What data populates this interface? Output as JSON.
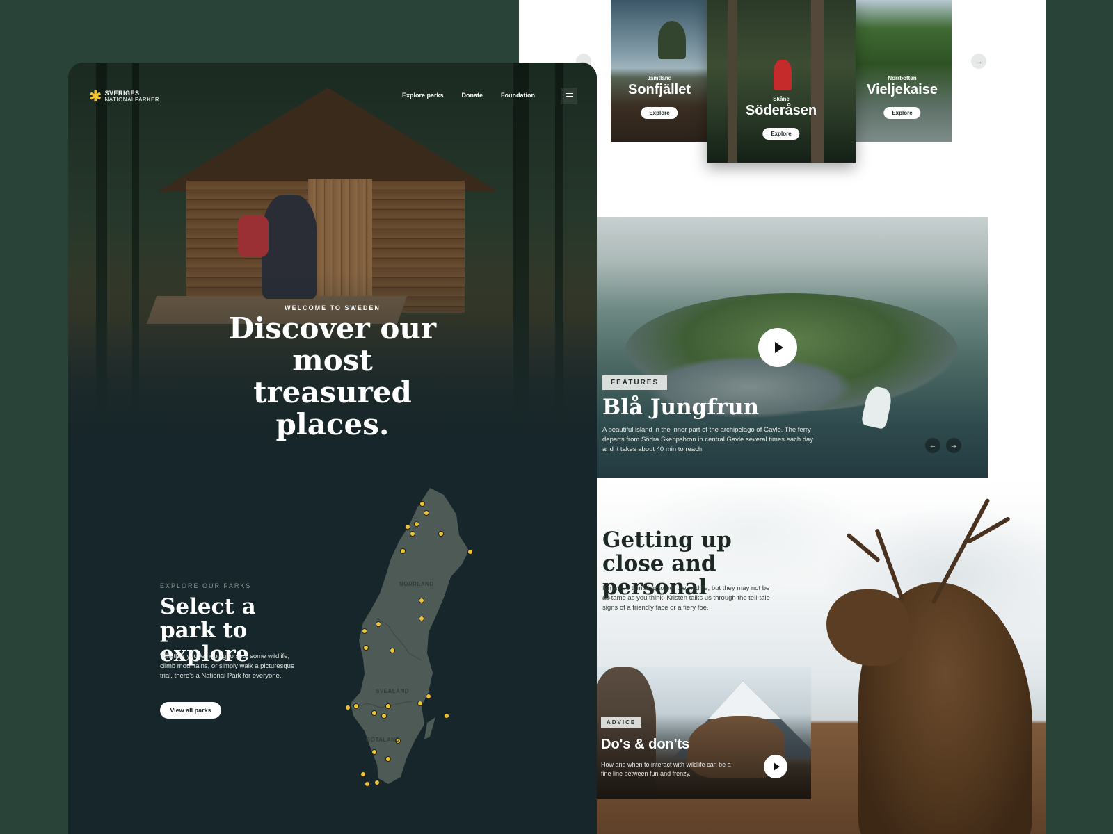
{
  "right_page": {
    "parks": [
      {
        "region": "Jämtland",
        "name": "Sonfjället",
        "explore": "Explore"
      },
      {
        "region": "Skåne",
        "name": "Söderåsen",
        "explore": "Explore"
      },
      {
        "region": "Norrbotten",
        "name": "Vieljekaise",
        "explore": "Explore"
      }
    ],
    "feature": {
      "tag": "FEATURES",
      "title": "Blå Jungfrun",
      "description": "A beautiful island in the inner part of the archipelago of Gavle. The ferry departs from Södra Skeppsbron in central Gavle several times each day and it takes about 40 min to reach"
    },
    "close_personal": {
      "title": "Getting up close and personal",
      "body": "It may be tempting to pet the wildlife, but they may not be as tame as you think. Kristen talks us through the tell-tale signs of a friendly face or a fiery foe."
    },
    "advice": {
      "tag": "ADVICE",
      "title": "Do's & don'ts",
      "description": "How and when to interact with wildlife can be a fine line between fun and frenzy."
    }
  },
  "left_page": {
    "logo": {
      "line1": "SVERIGES",
      "line2": "NATIONALPARKER"
    },
    "nav": {
      "explore": "Explore parks",
      "donate": "Donate",
      "foundation": "Foundation"
    },
    "hero": {
      "kicker": "WELCOME TO SWEDEN",
      "title": "Discover our most treasured places."
    },
    "explore": {
      "kicker": "EXPLORE OUR PARKS",
      "title": "Select a park to explore",
      "description": "Whether you're hoping to spot some wildlife, climb mountains, or simply walk a picturesque trial, there's a National Park for everyone.",
      "button": "View all parks"
    },
    "map": {
      "regions": [
        "NORRLAND",
        "SVEALAND",
        "GÖTALAND"
      ]
    }
  },
  "colors": {
    "accent": "#f2c232",
    "dark_bg": "#17262a",
    "page_bg": "#2a4339"
  }
}
